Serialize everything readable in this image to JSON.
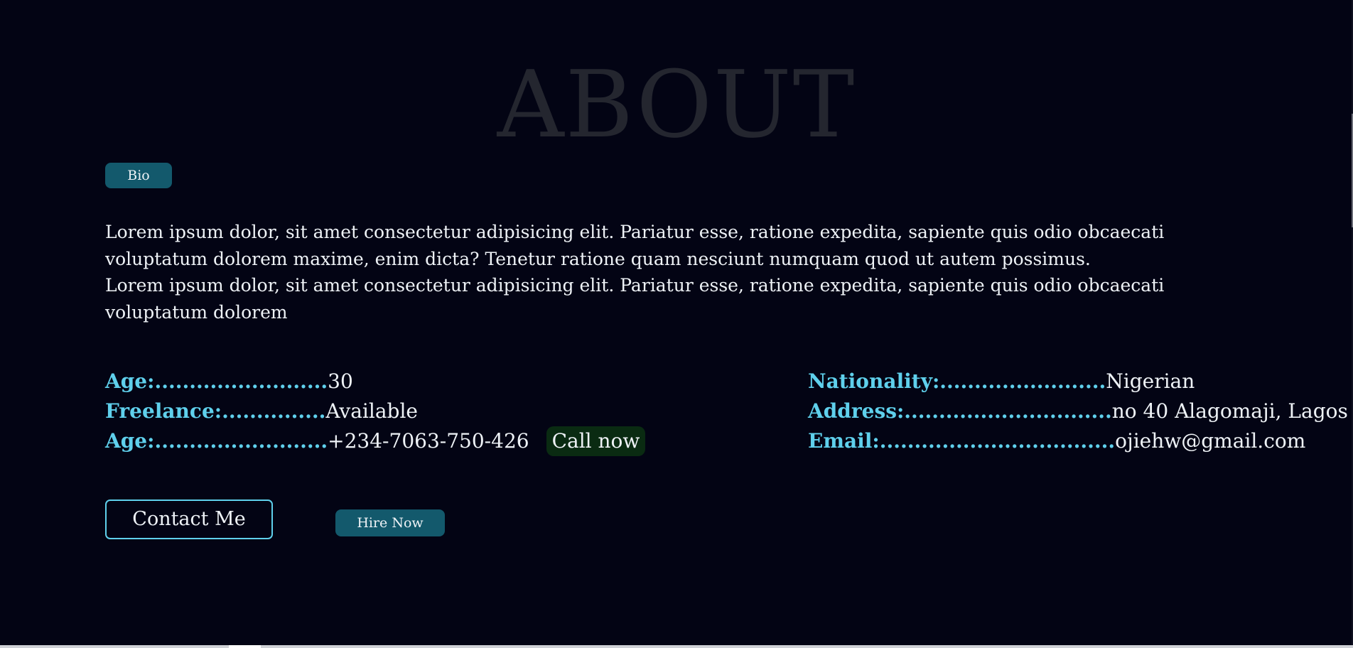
{
  "about": {
    "title": "ABOUT",
    "bio_tag": "Bio",
    "bio_paragraph_1": "Lorem ipsum dolor, sit amet consectetur adipisicing elit. Pariatur esse, ratione expedita, sapiente quis odio obcaecati voluptatum dolorem maxime, enim dicta? Tenetur ratione quam nesciunt numquam quod ut autem possimus.",
    "bio_paragraph_2": "Lorem ipsum dolor, sit amet consectetur adipisicing elit. Pariatur esse, ratione expedita, sapiente quis odio obcaecati voluptatum dolorem"
  },
  "info_left": [
    {
      "label": "Age:.........................",
      "value": "30"
    },
    {
      "label": "Freelance:...............",
      "value": "Available"
    },
    {
      "label": "Age:.........................",
      "value": "+234-7063-750-426",
      "action": "Call now"
    }
  ],
  "info_right": [
    {
      "label": "Nationality:........................",
      "value": "Nigerian"
    },
    {
      "label": "Address:..............................",
      "value": "no 40 Alagomaji, Lagos"
    },
    {
      "label": "Email:..................................",
      "value": "ojiehw@gmail.com"
    }
  ],
  "buttons": {
    "contact": "Contact Me",
    "hire": "Hire Now"
  },
  "colors": {
    "background": "#030414",
    "accent": "#5fd0ec",
    "button_fill": "#13596c",
    "call_fill": "#0a2b12",
    "title_faded": "#24262f"
  }
}
